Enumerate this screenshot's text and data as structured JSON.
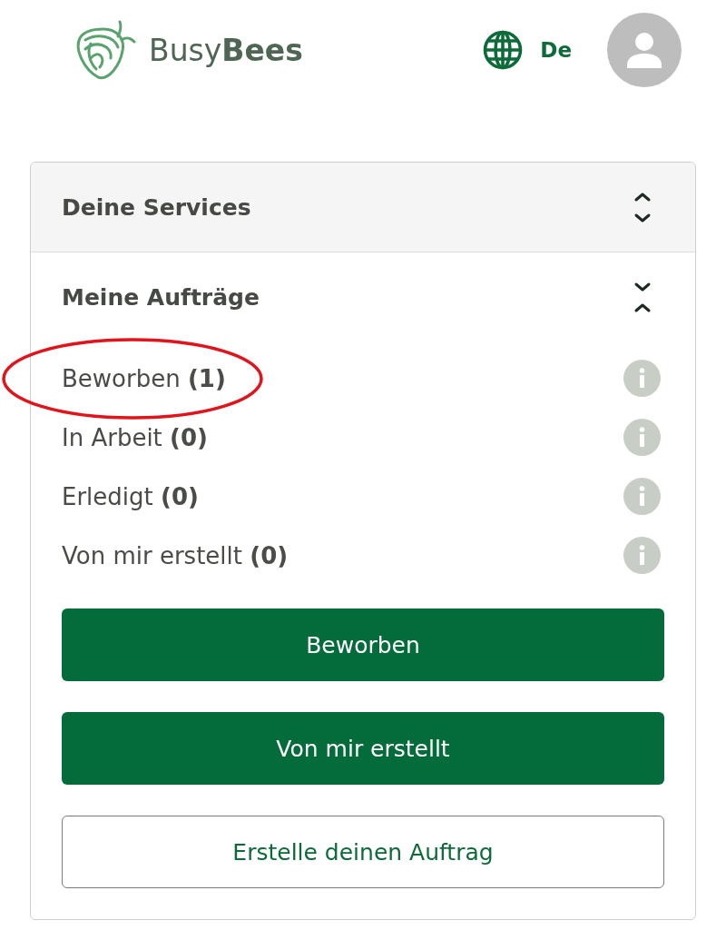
{
  "header": {
    "brand": "Busy**Bees**",
    "language": "De"
  },
  "sections": [
    {
      "title": "Deine Services",
      "expanded": false
    },
    {
      "title": "Meine Aufträge",
      "expanded": true,
      "items": [
        {
          "label": "Beworben **(1)**",
          "highlighted": true
        },
        {
          "label": "In Arbeit **(0)**",
          "highlighted": false
        },
        {
          "label": "Erledigt **(0)**",
          "highlighted": false
        },
        {
          "label": "Von mir erstellt **(0)**",
          "highlighted": false
        }
      ],
      "buttons": [
        {
          "label": "Beworben",
          "kind": "primary"
        },
        {
          "label": "Von mir erstellt",
          "kind": "primary"
        },
        {
          "label": "Erstelle deinen Auftrag",
          "kind": "outline"
        }
      ]
    }
  ]
}
